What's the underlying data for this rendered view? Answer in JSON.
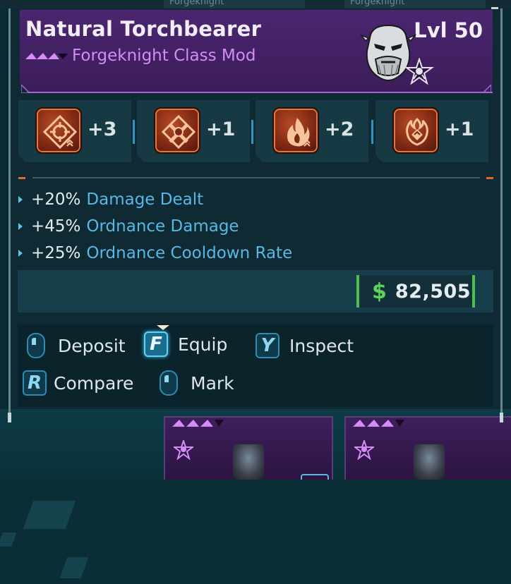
{
  "item": {
    "title": "Natural Torchbearer",
    "subtitle": "Forgeknight Class Mod",
    "level": "Lvl 50",
    "rarity_color": "#a662d6"
  },
  "skills": [
    {
      "icon": "crosshair-diamond-icon",
      "value": "+3"
    },
    {
      "icon": "crossed-guns-icon",
      "value": "+1"
    },
    {
      "icon": "flame-icon",
      "value": "+2"
    },
    {
      "icon": "fire-crest-icon",
      "value": "+1"
    }
  ],
  "stats": [
    {
      "value": "+20%",
      "name": "Damage Dealt"
    },
    {
      "value": "+45%",
      "name": "Ordnance Damage"
    },
    {
      "value": "+25%",
      "name": "Ordnance Cooldown Rate"
    }
  ],
  "price": {
    "symbol": "$",
    "amount": "82,505",
    "color": "#4cc04a"
  },
  "actions": {
    "deposit": {
      "key": "mouse",
      "label": "Deposit"
    },
    "equip": {
      "key": "F",
      "label": "Equip"
    },
    "inspect": {
      "key": "Y",
      "label": "Inspect"
    },
    "compare": {
      "key": "R",
      "label": "Compare"
    },
    "mark": {
      "key": "mouse",
      "label": "Mark"
    }
  },
  "background_tabs": [
    "Forgeknight",
    "Forgeknight"
  ]
}
